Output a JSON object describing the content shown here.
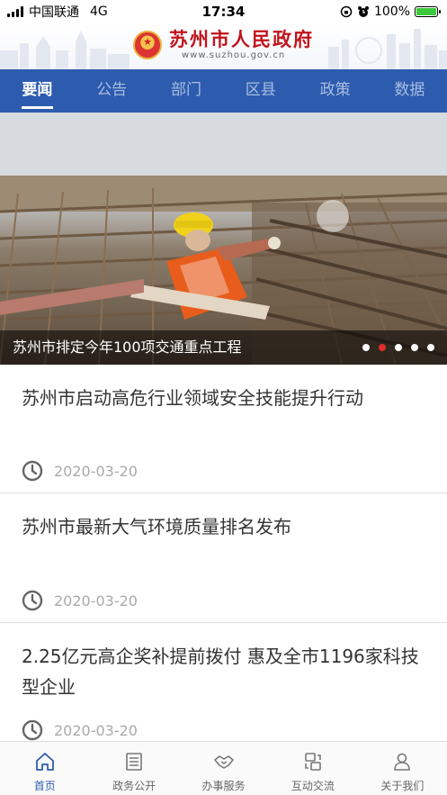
{
  "status_bar": {
    "carrier": "中国联通",
    "network": "4G",
    "time": "17:34",
    "battery": "100%"
  },
  "header": {
    "title": "苏州市人民政府",
    "url": "www.suzhou.gov.cn"
  },
  "tabs": [
    {
      "label": "要闻",
      "active": true
    },
    {
      "label": "公告",
      "active": false
    },
    {
      "label": "部门",
      "active": false
    },
    {
      "label": "区县",
      "active": false
    },
    {
      "label": "政策",
      "active": false
    },
    {
      "label": "数据",
      "active": false
    }
  ],
  "banner": {
    "caption": "苏州市排定今年100项交通重点工程",
    "slide_count": 5,
    "active_slide": 2
  },
  "news": [
    {
      "title": "苏州市启动高危行业领域安全技能提升行动",
      "date": "2020-03-20"
    },
    {
      "title": "苏州市最新大气环境质量排名发布",
      "date": "2020-03-20"
    },
    {
      "title": "2.25亿元高企奖补提前拨付 惠及全市1196家科技型企业",
      "date": "2020-03-20"
    }
  ],
  "bottom_nav": [
    {
      "label": "首页",
      "icon": "home-icon",
      "active": true
    },
    {
      "label": "政务公开",
      "icon": "document-icon",
      "active": false
    },
    {
      "label": "办事服务",
      "icon": "handshake-icon",
      "active": false
    },
    {
      "label": "互动交流",
      "icon": "exchange-icon",
      "active": false
    },
    {
      "label": "关于我们",
      "icon": "user-icon",
      "active": false
    }
  ],
  "colors": {
    "primary": "#2d5cae",
    "title_red": "#c0141c",
    "dot_active": "#e0302b"
  }
}
